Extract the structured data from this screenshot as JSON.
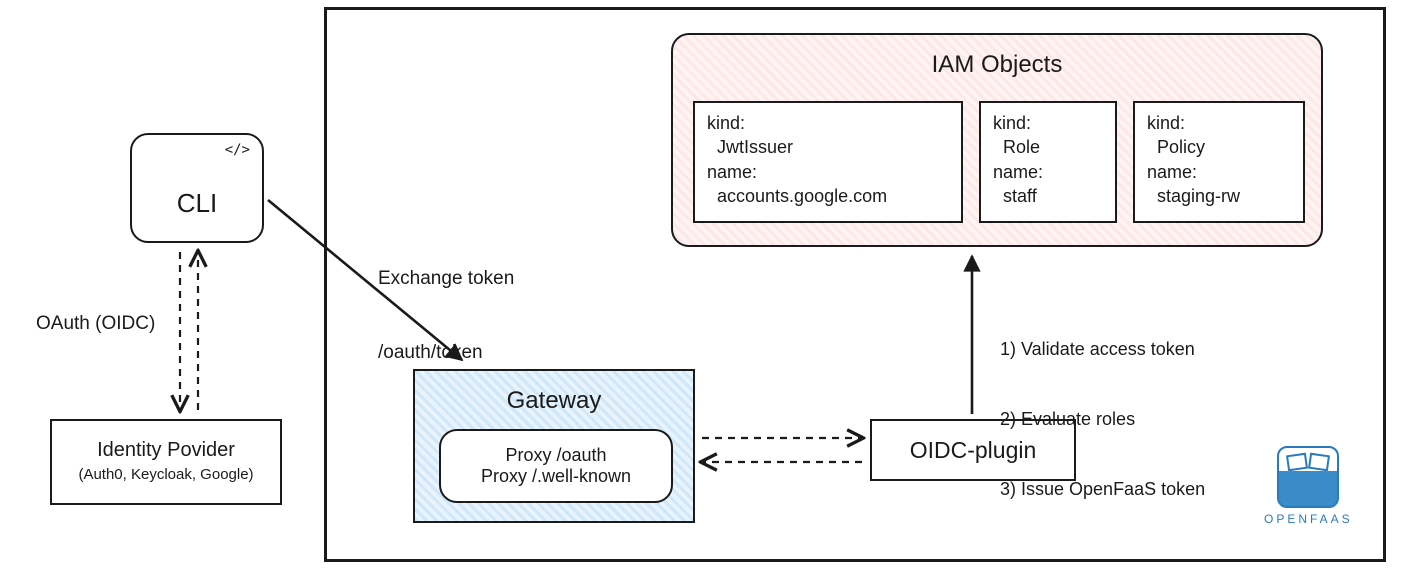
{
  "cli": {
    "label": "CLI",
    "code_icon": "</>"
  },
  "idp": {
    "title": "Identity Povider",
    "subtitle": "(Auth0, Keycloak, Google)"
  },
  "oauth_label": "OAuth (OIDC)",
  "exchange": {
    "line1": "Exchange token",
    "line2": "/oauth/token"
  },
  "gateway": {
    "title": "Gateway",
    "proxy1": "Proxy /oauth",
    "proxy2": "Proxy /.well-known"
  },
  "oidc_plugin": {
    "label": "OIDC-plugin"
  },
  "steps": {
    "s1": "1) Validate access token",
    "s2": "2) Evaluate roles",
    "s3": "3) Issue OpenFaaS token"
  },
  "iam": {
    "title": "IAM Objects",
    "obj1": {
      "kind_label": "kind:",
      "kind": "JwtIssuer",
      "name_label": "name:",
      "name": "accounts.google.com"
    },
    "obj2": {
      "kind_label": "kind:",
      "kind": "Role",
      "name_label": "name:",
      "name": "staff"
    },
    "obj3": {
      "kind_label": "kind:",
      "kind": "Policy",
      "name_label": "name:",
      "name": "staging-rw"
    }
  },
  "logo": {
    "text": "OPENFAAS"
  },
  "chart_data": {
    "type": "diagram",
    "nodes": [
      {
        "id": "cli",
        "label": "CLI"
      },
      {
        "id": "idp",
        "label": "Identity Provider (Auth0, Keycloak, Google)"
      },
      {
        "id": "gateway",
        "label": "Gateway (Proxy /oauth, Proxy /.well-known)"
      },
      {
        "id": "oidc-plugin",
        "label": "OIDC-plugin"
      },
      {
        "id": "iam",
        "label": "IAM Objects",
        "children": [
          {
            "kind": "JwtIssuer",
            "name": "accounts.google.com"
          },
          {
            "kind": "Role",
            "name": "staff"
          },
          {
            "kind": "Policy",
            "name": "staging-rw"
          }
        ]
      }
    ],
    "edges": [
      {
        "from": "cli",
        "to": "idp",
        "label": "OAuth (OIDC)",
        "style": "dashed-bidirectional"
      },
      {
        "from": "cli",
        "to": "gateway",
        "label": "Exchange token /oauth/token",
        "style": "solid"
      },
      {
        "from": "gateway",
        "to": "oidc-plugin",
        "style": "dashed-bidirectional"
      },
      {
        "from": "oidc-plugin",
        "to": "iam",
        "label": "1) Validate access token 2) Evaluate roles 3) Issue OpenFaaS token",
        "style": "solid"
      }
    ],
    "container": "OpenFaaS boundary contains Gateway, OIDC-plugin, IAM Objects"
  }
}
